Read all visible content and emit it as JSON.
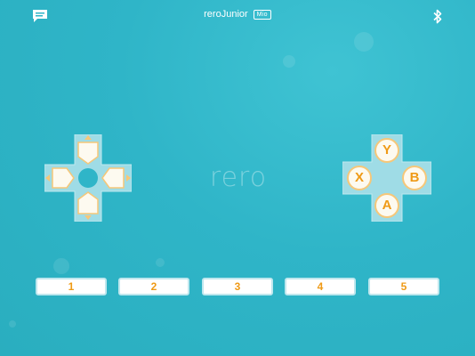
{
  "header": {
    "title": "reroJunior",
    "badge": "Mio",
    "left_icon": "chat-icon",
    "right_icon": "bluetooth-icon"
  },
  "logo": {
    "text": "rero"
  },
  "dpad": {
    "buttons": [
      "up",
      "down",
      "left",
      "right",
      "center"
    ]
  },
  "face_buttons": {
    "y": "Y",
    "x": "X",
    "b": "B",
    "a": "A"
  },
  "number_buttons": [
    "1",
    "2",
    "3",
    "4",
    "5"
  ],
  "colors": {
    "background": "#2fb5c8",
    "accent": "#ef9a16",
    "button_fill": "#fdfaf0",
    "pad_panel": "#9fdce6"
  }
}
